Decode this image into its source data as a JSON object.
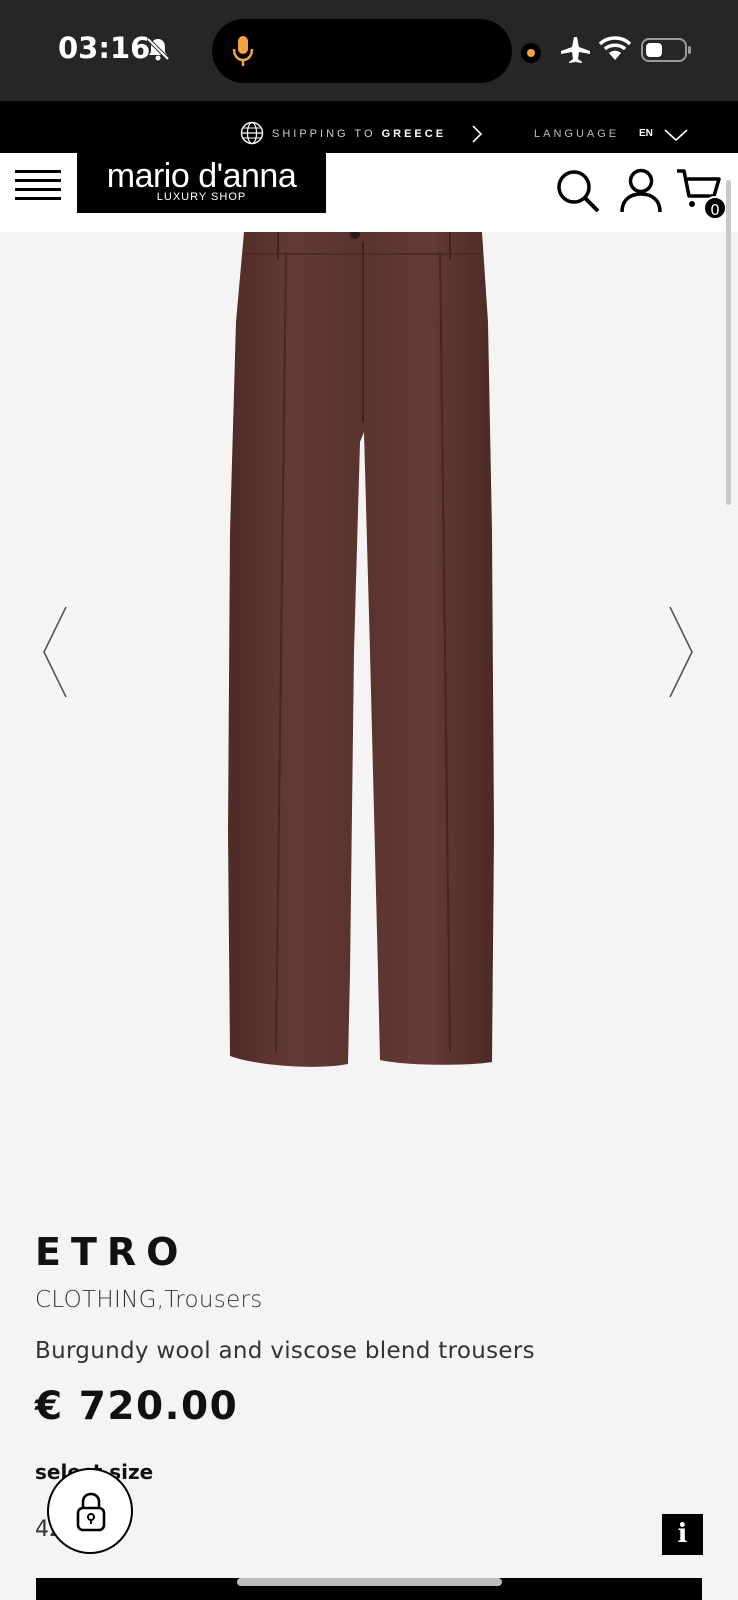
{
  "status_bar": {
    "time": "03:16",
    "icons": [
      "bell-slash-icon",
      "microphone-icon",
      "camera-dot-icon",
      "airplane-icon",
      "wifi-icon",
      "battery-icon"
    ]
  },
  "promo_bar": {
    "shipping_prefix": "SHIPPING TO",
    "shipping_country": "GREECE",
    "language_label": "LANGUAGE",
    "language_code": "EN"
  },
  "header": {
    "logo_main": "mario d'anna",
    "logo_sub": "LUXURY SHOP",
    "cart_count": "0"
  },
  "product": {
    "brand": "ETRO",
    "category": "CLOTHING,Trousers",
    "description": "Burgundy wool and viscose blend trousers",
    "price": "€ 720.00",
    "size_label": "select size",
    "size_value": "42",
    "image_color": "#5c3530"
  },
  "floating": {
    "info_label": "i"
  }
}
